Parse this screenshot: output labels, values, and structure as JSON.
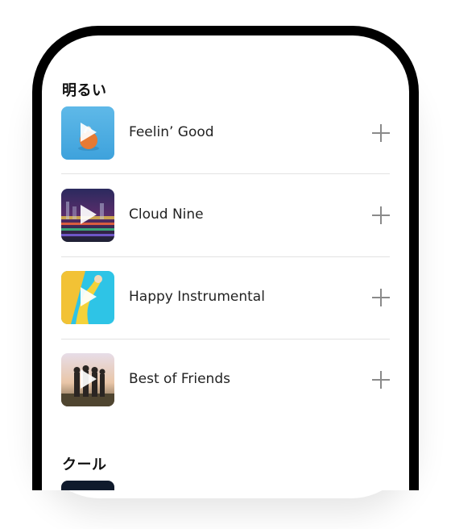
{
  "sections": [
    {
      "title": "明るい",
      "tracks": [
        {
          "title": "Feelin’ Good"
        },
        {
          "title": "Cloud Nine"
        },
        {
          "title": "Happy Instrumental"
        },
        {
          "title": "Best of Friends"
        }
      ]
    },
    {
      "title": "クール",
      "tracks": []
    }
  ],
  "icons": {
    "play": "play-icon",
    "add": "plus-icon"
  },
  "colors": {
    "frame": "#000000",
    "text": "#222222",
    "divider": "#e2e2e2",
    "add_icon": "#8a8a8a"
  }
}
